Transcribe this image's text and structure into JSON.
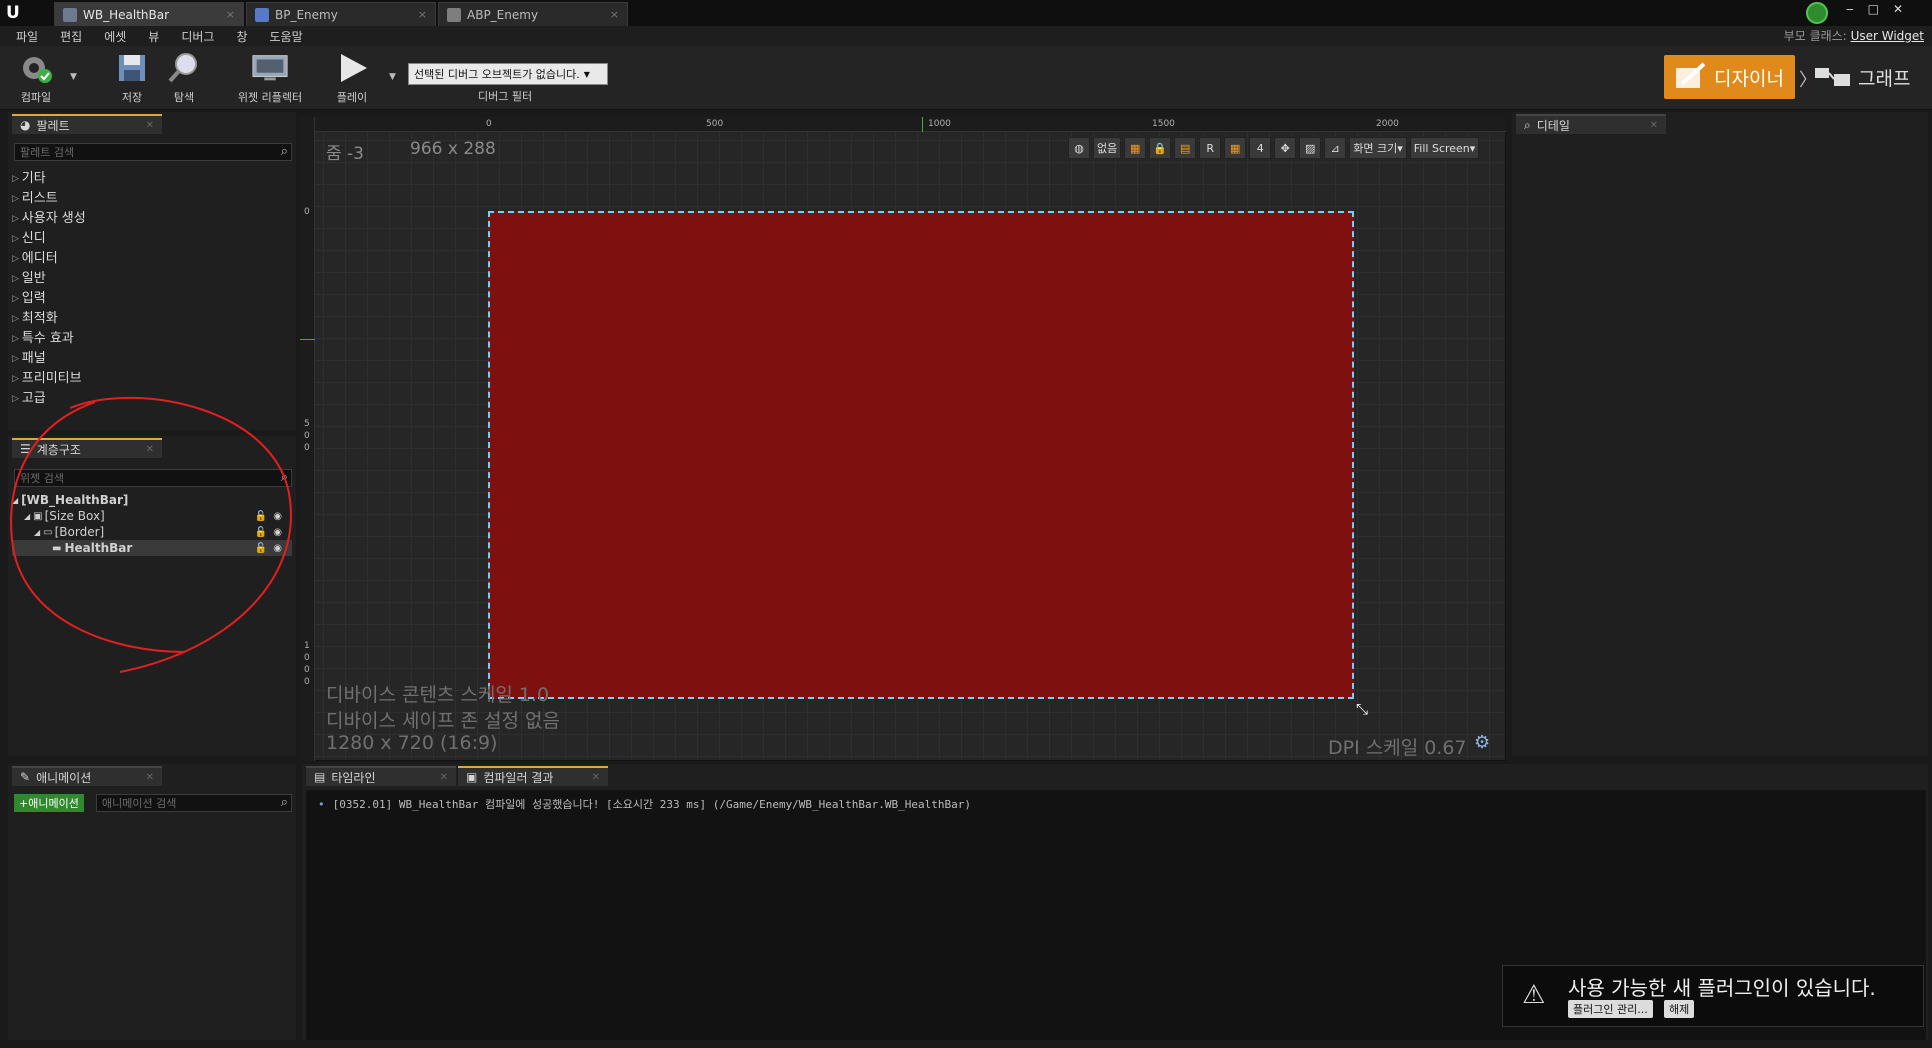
{
  "tabs": [
    {
      "label": "WB_HealthBar",
      "active": true
    },
    {
      "label": "BP_Enemy",
      "active": false
    },
    {
      "label": "ABP_Enemy",
      "active": false
    }
  ],
  "menu": [
    "파일",
    "편집",
    "에셋",
    "뷰",
    "디버그",
    "창",
    "도움말"
  ],
  "parent_class": {
    "label": "부모 클래스:",
    "value": "User Widget"
  },
  "toolbar": {
    "compile": "컴파일",
    "save": "저장",
    "browse": "탐색",
    "widget_reflector": "위젯 리플렉터",
    "play": "플레이",
    "debug_select": "선택된 디버그 오브젝트가 없습니다.",
    "debug_filter": "디버그 필터",
    "designer": "디자이너",
    "graph": "그래프"
  },
  "palette": {
    "tab": "팔레트",
    "search_placeholder": "팔레트 검색",
    "categories": [
      "기타",
      "리스트",
      "사용자 생성",
      "신디",
      "에디터",
      "일반",
      "입력",
      "최적화",
      "특수 효과",
      "패널",
      "프리미티브",
      "고급"
    ]
  },
  "hierarchy": {
    "tab": "계층구조",
    "search_placeholder": "위젯 검색",
    "items": [
      "[WB_HealthBar]",
      "[Size Box]",
      "[Border]",
      "HealthBar"
    ]
  },
  "details": {
    "tab": "디테일"
  },
  "designer": {
    "zoom": "줌 -3",
    "size": "966 x 288",
    "tools": {
      "none": "없음",
      "r": "R",
      "four": "4",
      "screen_size": "화면 크기",
      "fill_screen": "Fill Screen"
    },
    "ruler_top": [
      "0",
      "500",
      "1000",
      "1500",
      "2000"
    ],
    "ruler_left": [
      "0",
      "5",
      "0",
      "0",
      "1",
      "0",
      "0",
      "0"
    ],
    "device_scale": "디바이스 콘텐츠 스케일 1.0",
    "safe_zone": "디바이스 세이프 존 설정 없음",
    "resolution": "1280 x 720 (16:9)",
    "dpi_scale": "DPI 스케일 0.67"
  },
  "animations": {
    "tab": "애니메이션",
    "add_button": "+애니메이션",
    "search_placeholder": "애니메이션 검색"
  },
  "bottom_tabs": {
    "timeline": "타임라인",
    "compiler": "컴파일러 결과"
  },
  "log": {
    "line": "[0352.01] WB_HealthBar 컴파일에 성공했습니다! [소요시간 233 ms] (/Game/Enemy/WB_HealthBar.WB_HealthBar)"
  },
  "notification": {
    "text": "사용 가능한 새 플러그인이 있습니다.",
    "manage": "플러그인 관리...",
    "dismiss": "해제"
  },
  "colors": {
    "accent": "#e08a1c",
    "widget_fill": "#7f1010",
    "selection": "#6ad4ff",
    "annotation": "#e02020"
  }
}
